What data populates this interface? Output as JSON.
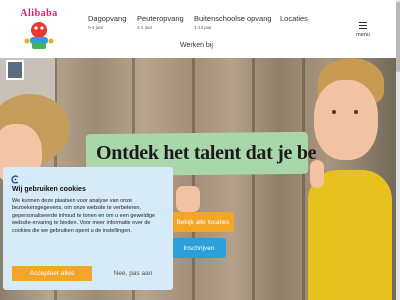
{
  "logo": {
    "text": "Alibaba"
  },
  "nav": {
    "items": [
      {
        "label": "Dagopvang",
        "sub": "0-4 jaar"
      },
      {
        "label": "Peuteropvang",
        "sub": "2-4 jaar"
      },
      {
        "label": "Buitenschoolse opvang",
        "sub": "4-13 jaar"
      },
      {
        "label": "Locaties",
        "sub": ""
      }
    ],
    "secondary": "Werken bij",
    "menu_label": "menu"
  },
  "hero": {
    "headline": "Ontdek het talent dat je be",
    "btn_locations": "Bekijk alle locaties",
    "btn_register": "Inschrijven"
  },
  "cookie": {
    "title": "Wij gebruiken cookies",
    "body": "We kunnen deze plaatsen voor analyse van onze bezoekersgegevens, om onze website te verbeteren, gepersonaliseerde inhoud te tonen en om u een geweldige website-ervaring te bieden. Voor meer informatie over de cookies die we gebruiken opent u de instellingen.",
    "accept": "Accepteer alles",
    "reject": "Nee, pas aan"
  },
  "colors": {
    "accent_orange": "#f2a628",
    "accent_blue": "#2a9fd8",
    "headline_bg": "#aad6ab",
    "cookie_bg": "#d7eaf7",
    "brand_pink": "#d6246e"
  }
}
